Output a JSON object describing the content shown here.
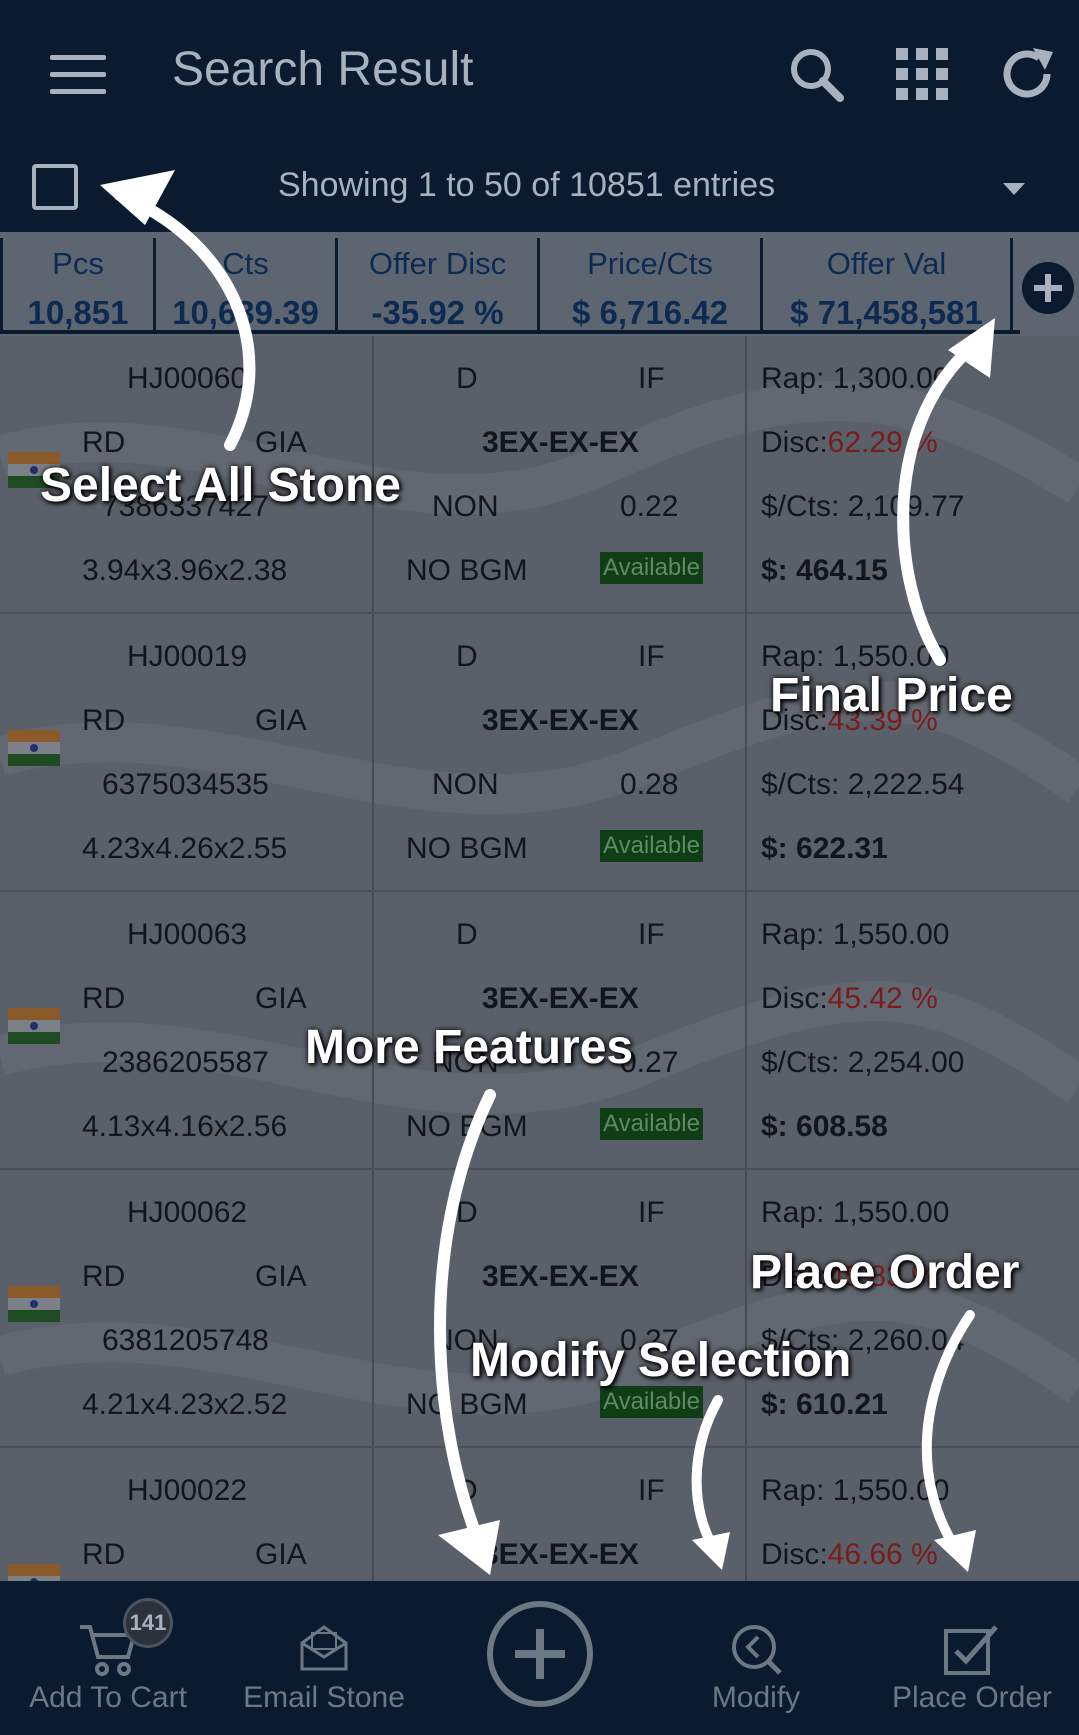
{
  "header": {
    "title": "Search Result",
    "icons": [
      "menu-icon",
      "search-icon",
      "grid-icon",
      "refresh-icon"
    ]
  },
  "subbar": {
    "entries_text": "Showing 1 to 50 of 10851 entries"
  },
  "summary": [
    {
      "label": "Pcs",
      "value": "10,851"
    },
    {
      "label": "Cts",
      "value": "10,639.39"
    },
    {
      "label": "Offer Disc",
      "value": "-35.92 %"
    },
    {
      "label": "Price/Cts",
      "value": "$ 6,716.42"
    },
    {
      "label": "Offer Val",
      "value": "$ 71,458,581"
    }
  ],
  "rows": [
    {
      "stone_id": "HJ00060",
      "shape": "RD",
      "lab": "GIA",
      "report_no": "7386337427",
      "measurements": "3.94x3.96x2.38",
      "color": "D",
      "clarity": "IF",
      "cut_pol_sym": "3EX-EX-EX",
      "fluor": "NON",
      "carat": "0.22",
      "bgm": "NO BGM",
      "status": "Available",
      "rap": "Rap: 1,300.00",
      "disc_label": "Disc:",
      "disc": "62.29 %",
      "per_cts": "$/Cts: 2,109.77",
      "final": "$: 464.15"
    },
    {
      "stone_id": "HJ00019",
      "shape": "RD",
      "lab": "GIA",
      "report_no": "6375034535",
      "measurements": "4.23x4.26x2.55",
      "color": "D",
      "clarity": "IF",
      "cut_pol_sym": "3EX-EX-EX",
      "fluor": "NON",
      "carat": "0.28",
      "bgm": "NO BGM",
      "status": "Available",
      "rap": "Rap: 1,550.00",
      "disc_label": "Disc:",
      "disc": "43.39 %",
      "per_cts": "$/Cts: 2,222.54",
      "final": "$: 622.31"
    },
    {
      "stone_id": "HJ00063",
      "shape": "RD",
      "lab": "GIA",
      "report_no": "2386205587",
      "measurements": "4.13x4.16x2.56",
      "color": "D",
      "clarity": "IF",
      "cut_pol_sym": "3EX-EX-EX",
      "fluor": "NON",
      "carat": "0.27",
      "bgm": "NO BGM",
      "status": "Available",
      "rap": "Rap: 1,550.00",
      "disc_label": "Disc:",
      "disc": "45.42 %",
      "per_cts": "$/Cts: 2,254.00",
      "final": "$: 608.58"
    },
    {
      "stone_id": "HJ00062",
      "shape": "RD",
      "lab": "GIA",
      "report_no": "6381205748",
      "measurements": "4.21x4.23x2.52",
      "color": "D",
      "clarity": "IF",
      "cut_pol_sym": "3EX-EX-EX",
      "fluor": "NON",
      "carat": "0.27",
      "bgm": "NO BGM",
      "status": "Available",
      "rap": "Rap: 1,550.00",
      "disc_label": "Disc:",
      "disc": "45.83 %",
      "per_cts": "$/Cts: 2,260.04",
      "final": "$: 610.21"
    },
    {
      "stone_id": "HJ00022",
      "shape": "RD",
      "lab": "GIA",
      "report_no": "",
      "measurements": "",
      "color": "D",
      "clarity": "IF",
      "cut_pol_sym": "3EX-EX-EX",
      "fluor": "",
      "carat": "",
      "bgm": "",
      "status": "",
      "rap": "Rap: 1,550.00",
      "disc_label": "Disc:",
      "disc": "46.66 %",
      "per_cts": "",
      "final": ""
    }
  ],
  "bottom_nav": {
    "cart_label": "Add To Cart",
    "cart_badge": "141",
    "email_label": "Email Stone",
    "modify_label": "Modify",
    "order_label": "Place Order"
  },
  "annotations": {
    "select_all": "Select All Stone",
    "final_price": "Final Price",
    "more_features": "More Features",
    "place_order": "Place Order",
    "modify_selection": "Modify Selection"
  },
  "colors": {
    "header_bg": "#0a1b30",
    "summary_text": "#0d2b52",
    "available_bg": "#0f3d16",
    "discount_red": "#7a1c1c"
  }
}
